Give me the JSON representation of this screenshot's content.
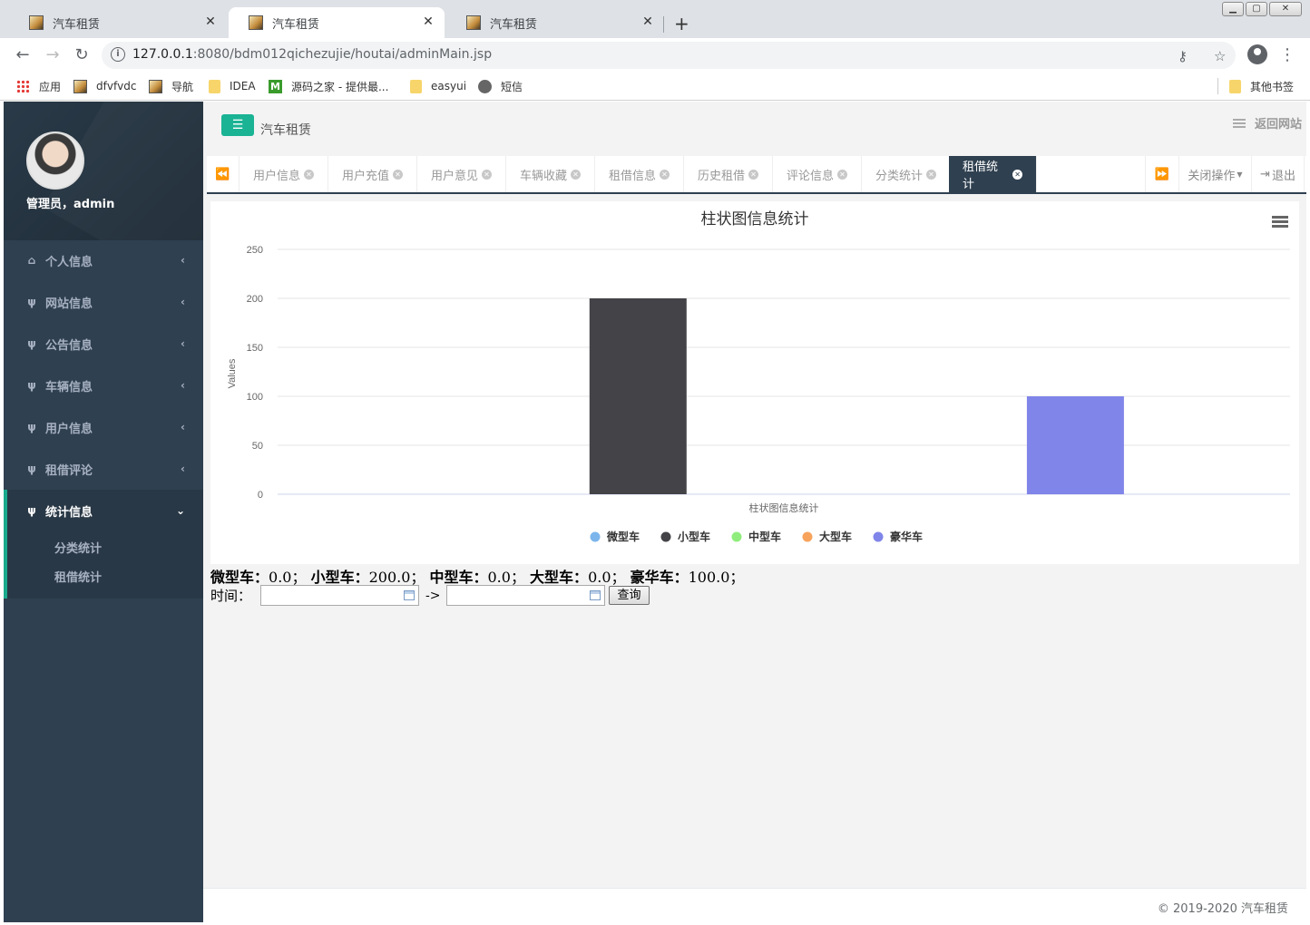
{
  "browser": {
    "tabs": [
      {
        "title": "汽车租赁",
        "active": false
      },
      {
        "title": "汽车租赁",
        "active": true
      },
      {
        "title": "汽车租赁",
        "active": false
      }
    ],
    "url_host": "127.0.0.1",
    "url_path": ":8080/bdm012qichezujie/houtai/adminMain.jsp",
    "bookmarks": [
      {
        "label": "应用",
        "icon": "apps-icon"
      },
      {
        "label": "dfvfvdc",
        "icon": "page-icon"
      },
      {
        "label": "导航",
        "icon": "page-icon"
      },
      {
        "label": "IDEA",
        "icon": "folder-icon"
      },
      {
        "label": "源码之家 - 提供最...",
        "icon": "m-icon"
      },
      {
        "label": "easyui",
        "icon": "folder-icon"
      },
      {
        "label": "短信",
        "icon": "globe-icon"
      }
    ],
    "other_bookmarks": "其他书签"
  },
  "sidebar": {
    "user": "管理员，admin",
    "items": [
      {
        "label": "个人信息",
        "icon": "home-icon"
      },
      {
        "label": "网站信息",
        "icon": "cutlery-icon"
      },
      {
        "label": "公告信息",
        "icon": "cutlery-icon"
      },
      {
        "label": "车辆信息",
        "icon": "cutlery-icon"
      },
      {
        "label": "用户信息",
        "icon": "cutlery-icon"
      },
      {
        "label": "租借评论",
        "icon": "cutlery-icon"
      },
      {
        "label": "统计信息",
        "icon": "cutlery-icon"
      }
    ],
    "subitems": [
      "分类统计",
      "租借统计"
    ]
  },
  "header": {
    "app_title": "汽车租赁",
    "back_site": "返回网站"
  },
  "page_tabs": [
    "用户信息",
    "用户充值",
    "用户意见",
    "车辆收藏",
    "租借信息",
    "历史租借",
    "评论信息",
    "分类统计",
    "租借统计"
  ],
  "tab_controls": {
    "close_ops": "关闭操作",
    "logout": "退出"
  },
  "chart_data": {
    "type": "bar",
    "title": "柱状图信息统计",
    "xlabel": "柱状图信息统计",
    "ylabel": "Values",
    "ylim": [
      0,
      250
    ],
    "yticks": [
      0,
      50,
      100,
      150,
      200,
      250
    ],
    "series": [
      {
        "name": "微型车",
        "value": 0,
        "color": "#7cb5ec"
      },
      {
        "name": "小型车",
        "value": 200,
        "color": "#434348"
      },
      {
        "name": "中型车",
        "value": 0,
        "color": "#90ed7d"
      },
      {
        "name": "大型车",
        "value": 0,
        "color": "#f7a35c"
      },
      {
        "name": "豪华车",
        "value": 100,
        "color": "#8085e9"
      }
    ]
  },
  "summary": [
    {
      "label": "微型车：",
      "value": "0.0；"
    },
    {
      "label": "小型车：",
      "value": "200.0；"
    },
    {
      "label": "中型车：",
      "value": "0.0；"
    },
    {
      "label": "大型车：",
      "value": "0.0；"
    },
    {
      "label": "豪华车：",
      "value": "100.0；"
    }
  ],
  "filter": {
    "time_label": "时间：",
    "sep": "->",
    "query_button": "查询"
  },
  "footer": {
    "copyright": "© 2019-2020 汽车租赁"
  }
}
